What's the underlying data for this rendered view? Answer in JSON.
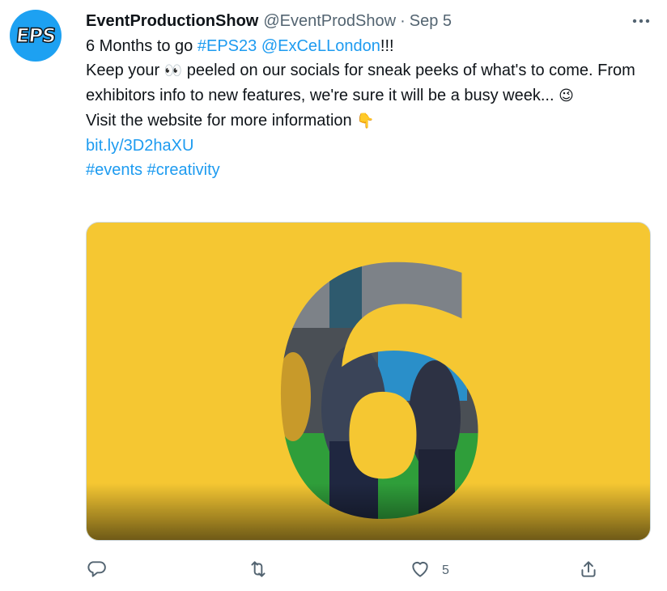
{
  "tweet": {
    "avatar_text": "EPS",
    "display_name": "EventProductionShow",
    "handle": "@EventProdShow",
    "separator": "·",
    "date": "Sep 5",
    "line1_prefix": "6 Months to go ",
    "line1_hashtag": "#EPS23",
    "line1_mention": "@ExCeLLondon",
    "line1_suffix": "!!!",
    "line2_a": "Keep your ",
    "line2_emoji": "👀",
    "line2_b": " peeled on our socials for sneak peeks of what's to come. From exhibitors info to new features, we're sure it will be a busy week... ",
    "line2_emoji2": "😉",
    "line3_text": "Visit the website for more information ",
    "line3_emoji": "👇",
    "link": "bit.ly/3D2haXU",
    "tag1": "#events",
    "tag2": "#creativity"
  },
  "actions": {
    "reply_icon": "reply-icon",
    "retweet_icon": "retweet-icon",
    "like_icon": "heart-icon",
    "like_count": "5",
    "share_icon": "share-icon"
  },
  "media": {
    "big_number": "6",
    "background_color": "#f5c732"
  }
}
